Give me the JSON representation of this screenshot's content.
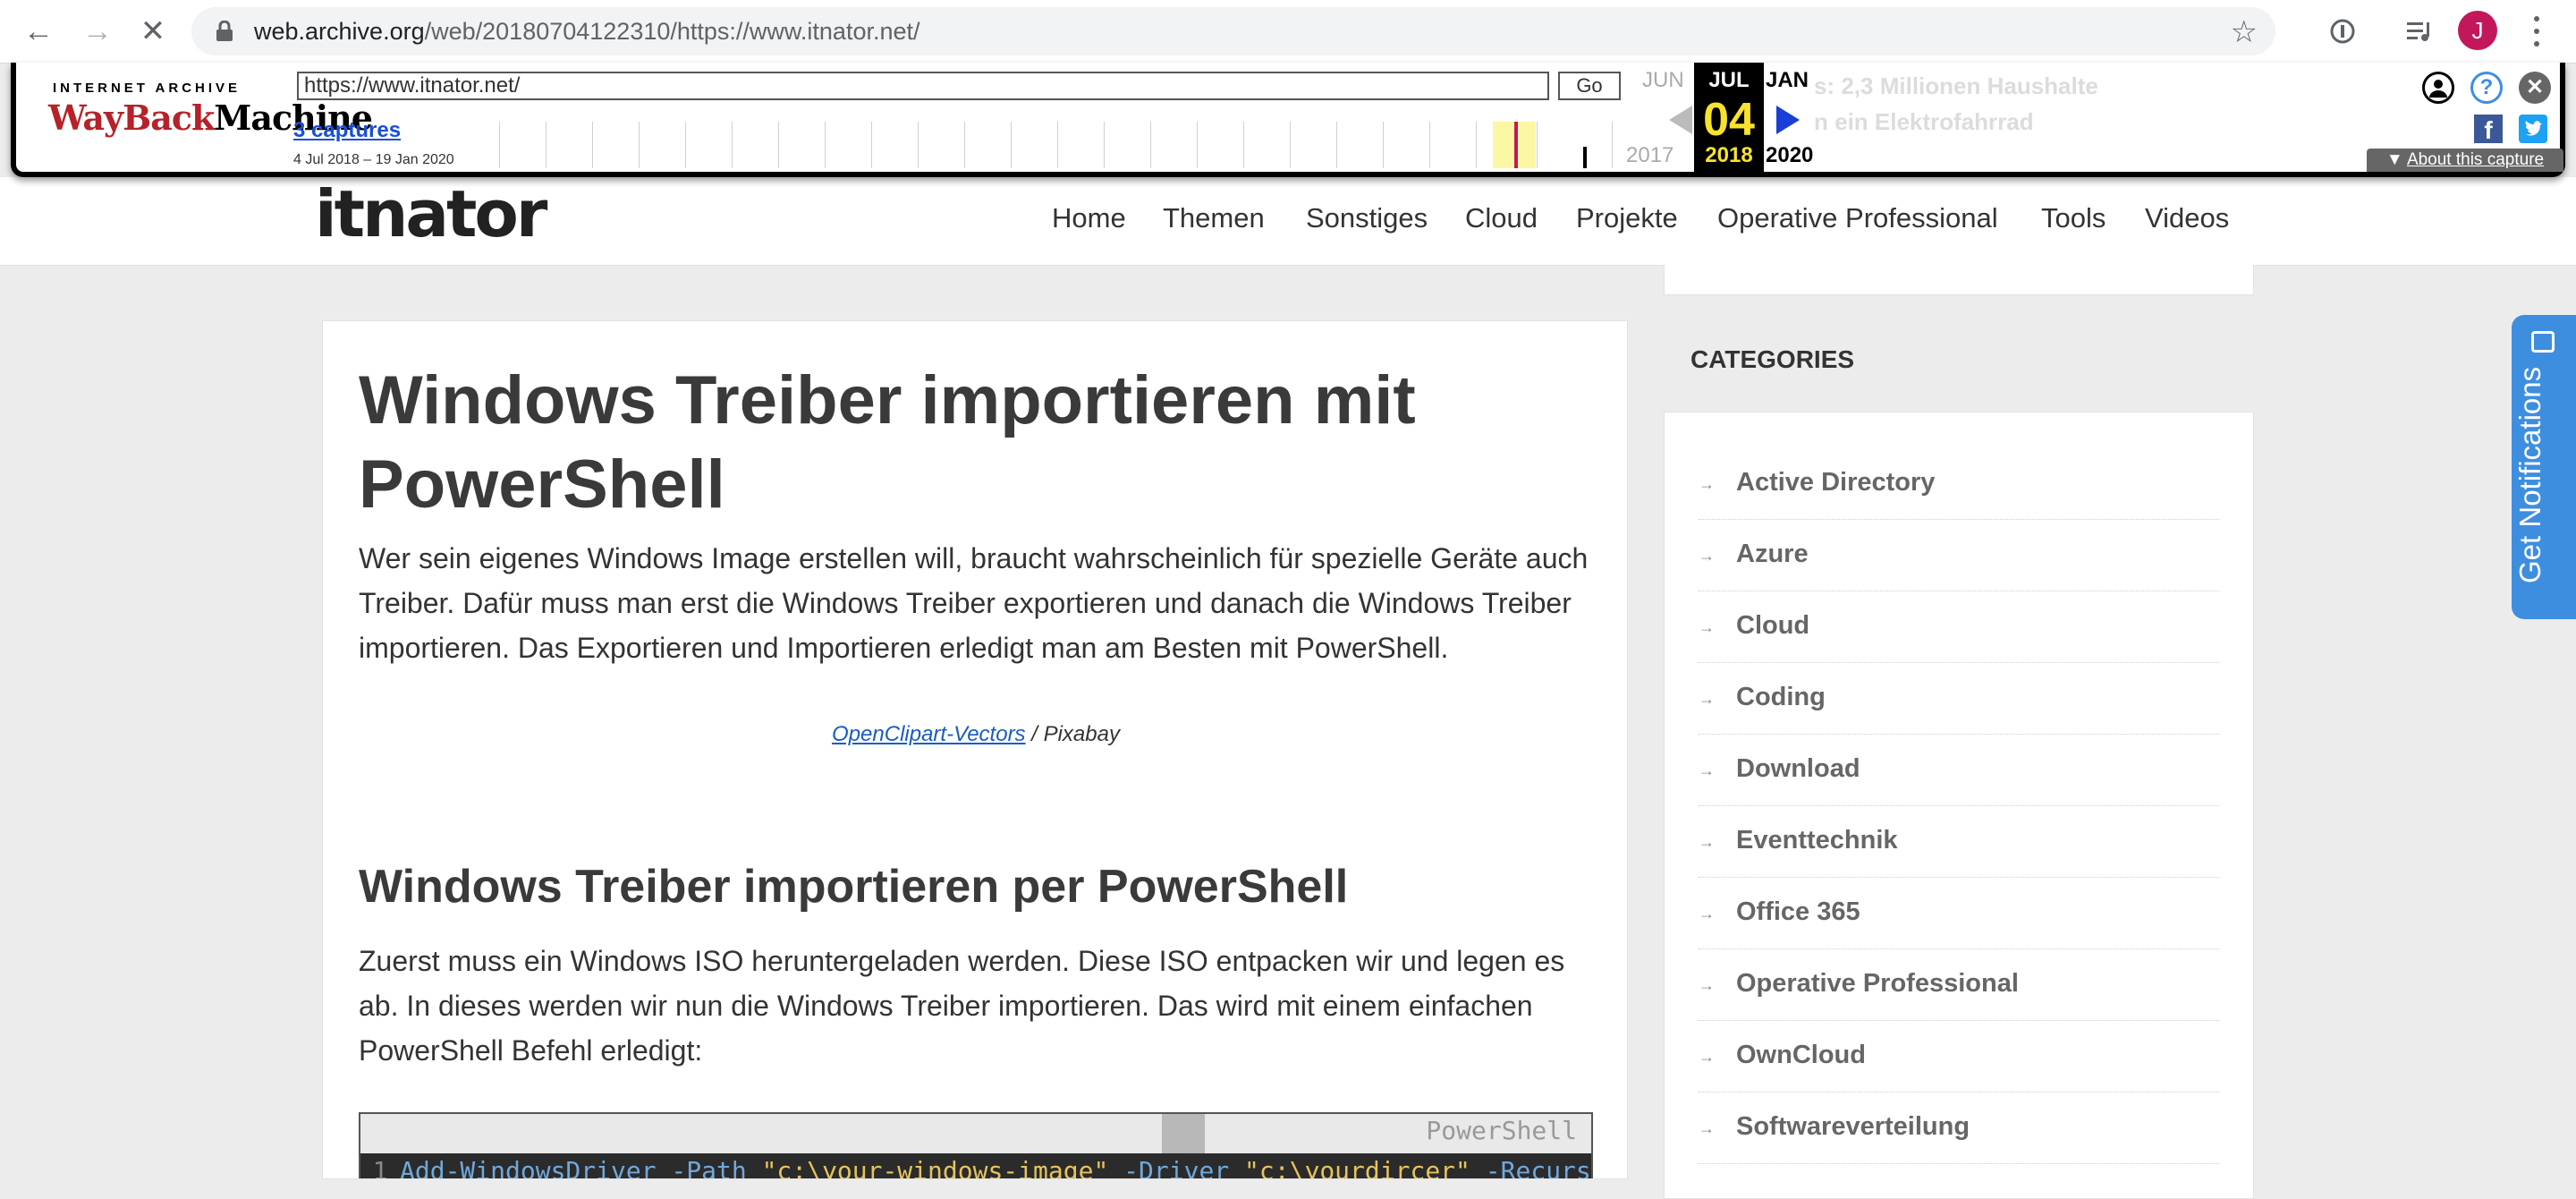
{
  "browser": {
    "url_host": "web.archive.org",
    "url_path": "/web/20180704122310/https://www.itnator.net/"
  },
  "wayback": {
    "logo_top": "INTERNET ARCHIVE",
    "logo_word1": "WayBack",
    "logo_word2": "Machine",
    "url_value": "https://www.itnator.net/",
    "go_label": "Go",
    "captures_label": "3 captures",
    "date_range": "4 Jul 2018 – 19 Jan 2020",
    "prev_month": "JUN",
    "cur_month": "JUL",
    "next_month": "JAN",
    "cur_day": "04",
    "prev_year": "2017",
    "cur_year": "2018",
    "next_year": "2020",
    "ghost_line1": "s: 2,3 Millionen Haushalte",
    "ghost_line2": "n ein Elektrofahrrad",
    "about_label": "About this capture"
  },
  "site": {
    "logo": "itnator",
    "nav": [
      "Home",
      "Themen",
      "Sonstiges",
      "Cloud",
      "Projekte",
      "Operative Professional",
      "Tools",
      "Videos"
    ]
  },
  "article": {
    "title": "Windows Treiber importieren mit PowerShell",
    "intro": "Wer sein eigenes Windows Image erstellen will, braucht wahrscheinlich für spezielle Geräte auch Treiber. Dafür muss man erst die Windows Treiber exportieren und danach die Windows Treiber importieren. Das Exportieren und Importieren erledigt man am Besten mit PowerShell.",
    "credit_link": "OpenClipart-Vectors",
    "credit_rest": " / Pixabay",
    "h2": "Windows Treiber importieren per PowerShell",
    "para2": "Zuerst muss ein Windows ISO heruntergeladen werden. Diese ISO entpacken wir und legen es ab. In dieses werden wir nun die Windows Treiber importieren. Das wird mit einem einfachen PowerShell Befehl erledigt:",
    "code_lang": "PowerShell",
    "code_line_no": "1",
    "code_cmd": "Add-WindowsDriver -Path ",
    "code_str1": "\"c:\\your-windows-image\"",
    "code_mid": " -Driver ",
    "code_str2": "\"c:\\yourdircer\"",
    "code_tail": " -Recurs"
  },
  "sidebar": {
    "heading": "CATEGORIES",
    "categories": [
      "Active Directory",
      "Azure",
      "Cloud",
      "Coding",
      "Download",
      "Eventtechnik",
      "Office 365",
      "Operative Professional",
      "OwnCloud",
      "Softwareverteilung"
    ]
  },
  "notifications": {
    "label": "Get Notifications"
  },
  "colors": {
    "wayback_red": "#b5222a",
    "wayback_yellow": "#f7e32c",
    "link_blue": "#1a4fd6",
    "notif_blue": "#3e8ee0"
  }
}
